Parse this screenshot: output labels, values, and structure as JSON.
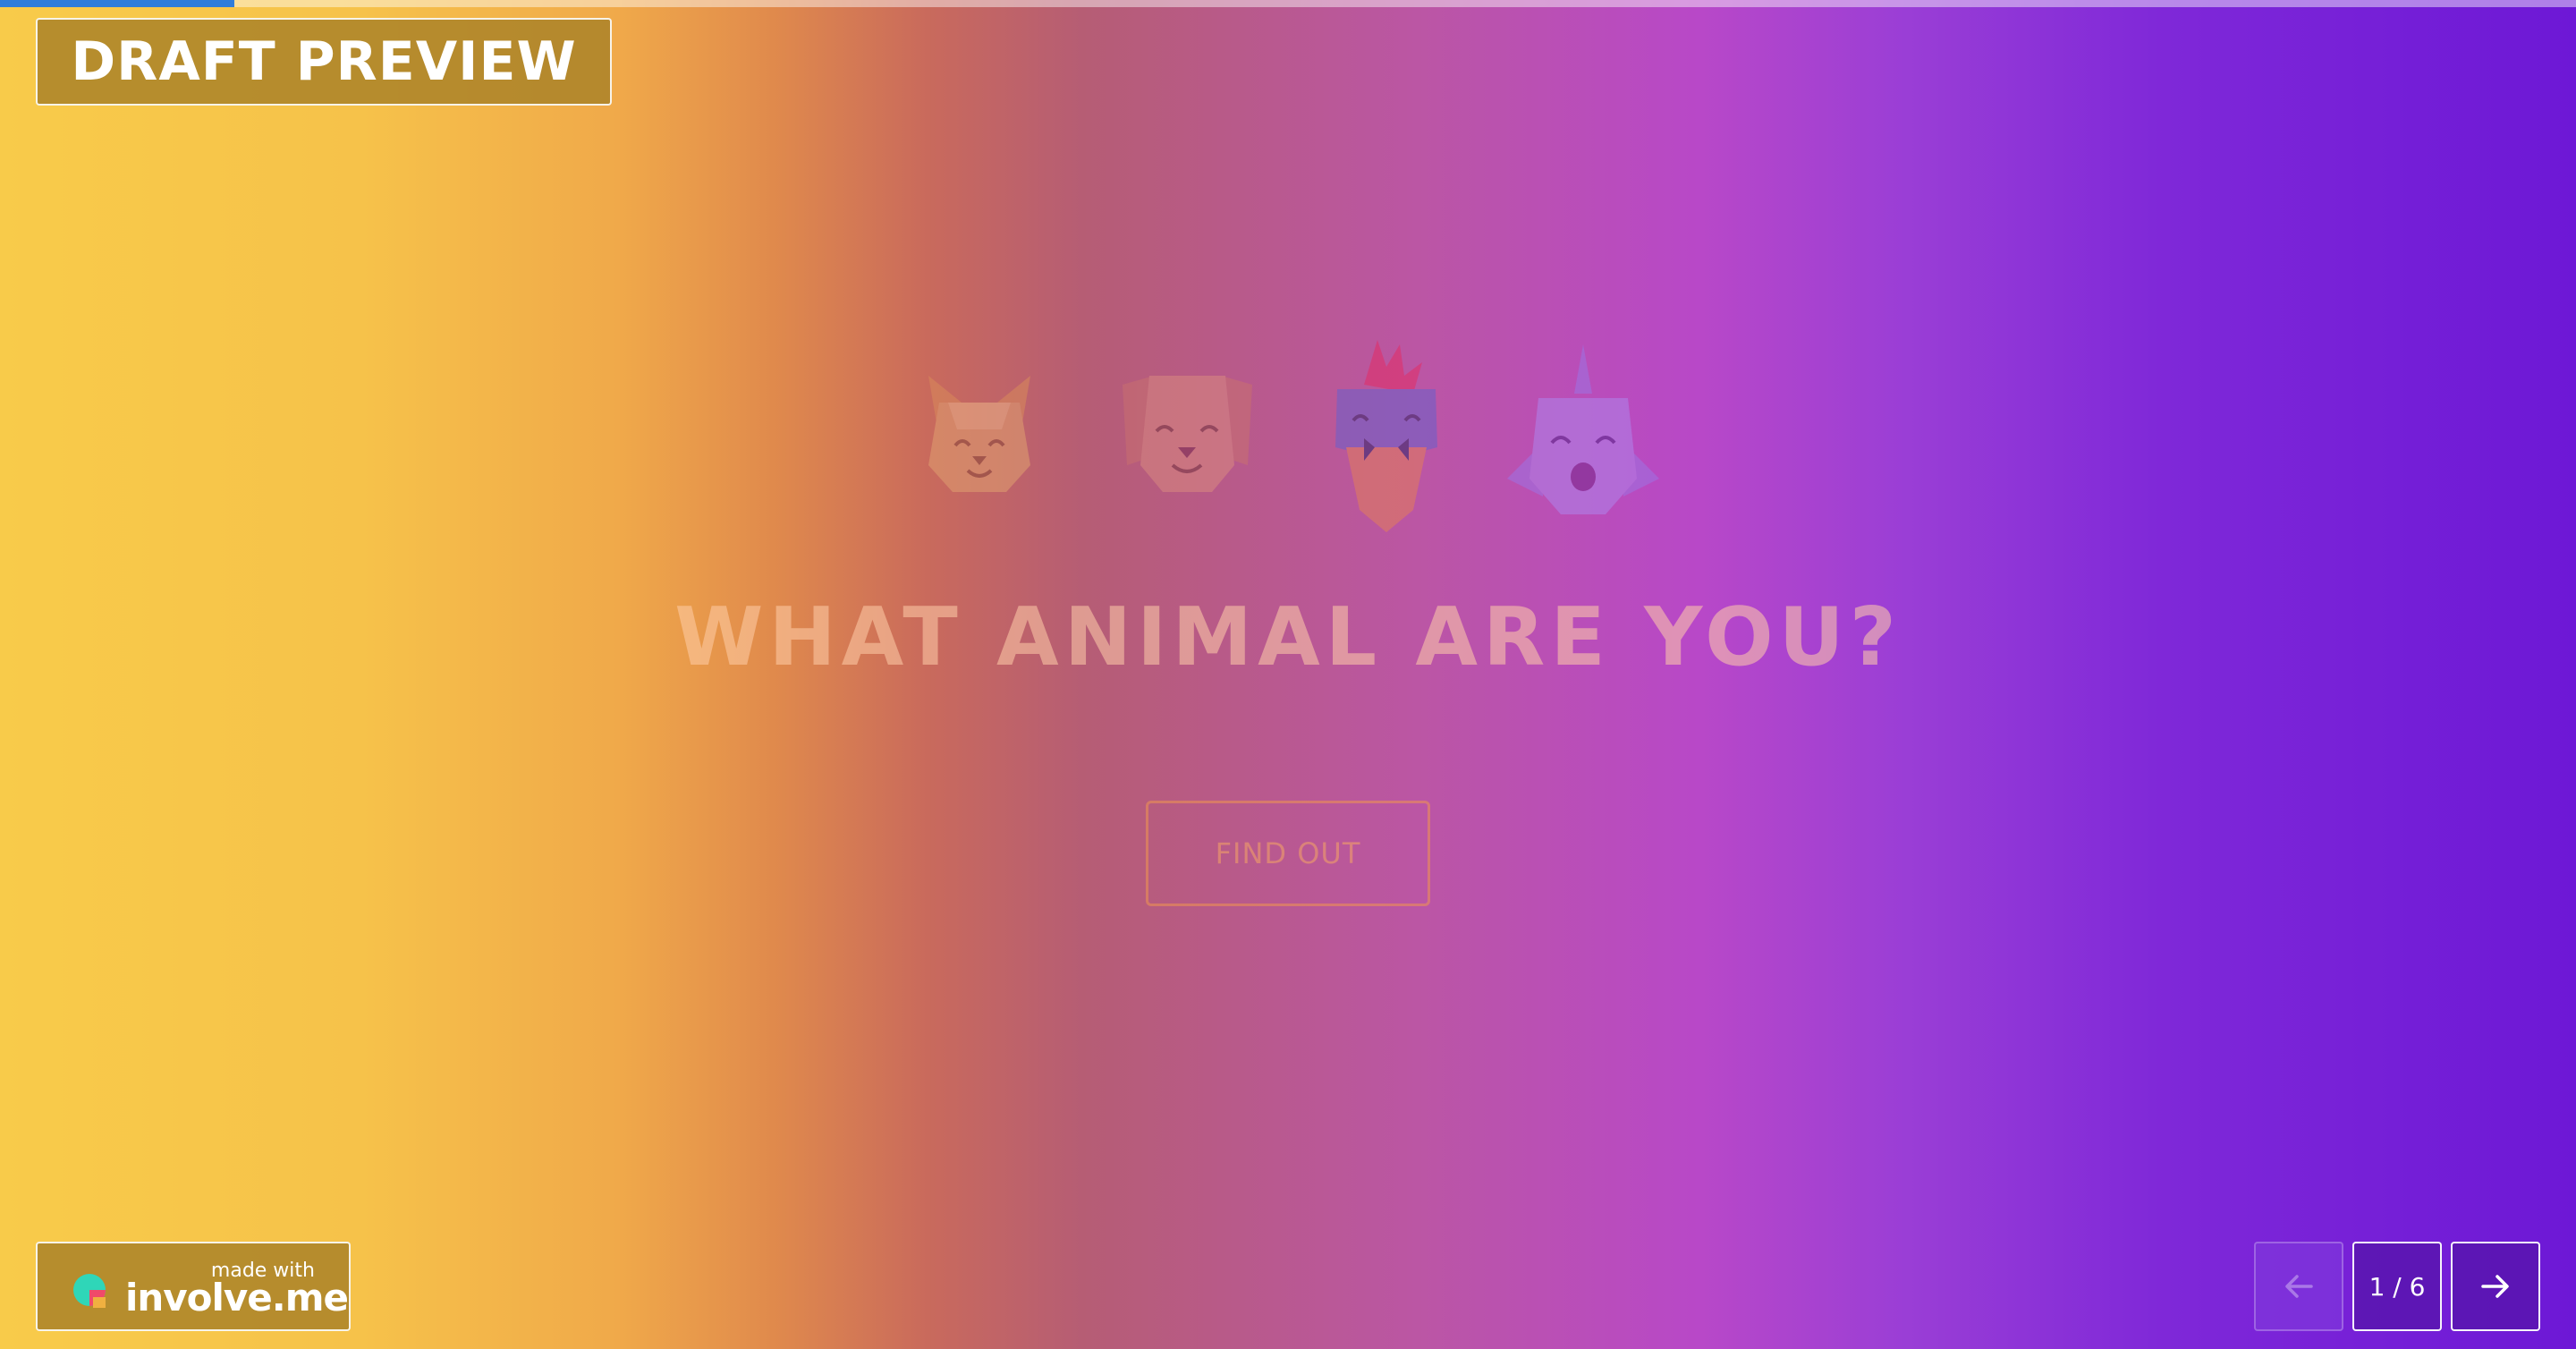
{
  "progress": {
    "fraction": 0.091
  },
  "badge": {
    "label": "DRAFT PREVIEW"
  },
  "hero": {
    "animals": [
      {
        "name": "cat"
      },
      {
        "name": "dog"
      },
      {
        "name": "bird"
      },
      {
        "name": "fish"
      }
    ],
    "title": "WHAT ANIMAL ARE YOU?",
    "cta_label": "FIND OUT"
  },
  "branding": {
    "made_with": "made with",
    "brand": "involve.me"
  },
  "navigation": {
    "prev_icon": "arrow-left-icon",
    "next_icon": "arrow-right-icon",
    "current_page": 1,
    "total_pages": 6,
    "page_counter": "1 / 6"
  },
  "colors": {
    "gradient_start": "#f8cb4a",
    "gradient_mid": "#bb56a4",
    "gradient_end": "#6d18d6",
    "progress_fill": "#2f7ddb"
  }
}
